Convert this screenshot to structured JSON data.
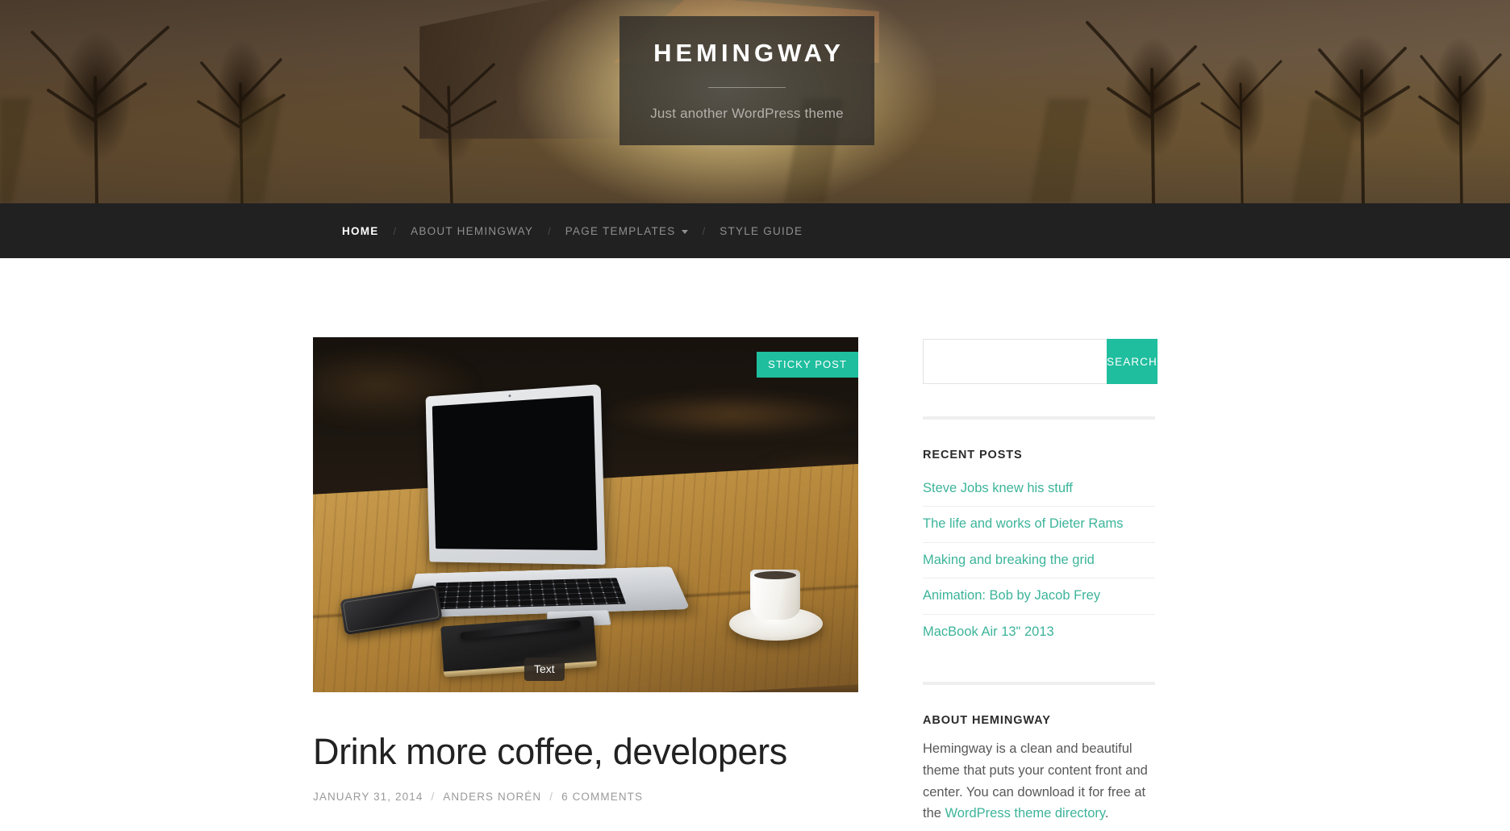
{
  "header": {
    "site_title": "HEMINGWAY",
    "tagline": "Just another WordPress theme",
    "hero_image_alt": "sunset-barn-field-photo"
  },
  "nav": {
    "separator": "/",
    "items": [
      {
        "label": "HOME",
        "active": true,
        "has_dropdown": false
      },
      {
        "label": "ABOUT HEMINGWAY",
        "active": false,
        "has_dropdown": false
      },
      {
        "label": "PAGE TEMPLATES",
        "active": false,
        "has_dropdown": true
      },
      {
        "label": "STYLE GUIDE",
        "active": false,
        "has_dropdown": false
      }
    ]
  },
  "post": {
    "featured_image_alt": "macbook-air-coffee-desk-photo",
    "sticky_badge": "STICKY POST",
    "format_badge": "Text",
    "title": "Drink more coffee, developers",
    "date": "JANUARY 31, 2014",
    "author": "ANDERS NORÉN",
    "comments": "6 COMMENTS",
    "meta_separator": "/"
  },
  "sidebar": {
    "search": {
      "value": "",
      "placeholder": "",
      "button_label": "SEARCH"
    },
    "recent_posts": {
      "title": "RECENT POSTS",
      "items": [
        "Steve Jobs knew his stuff",
        "The life and works of Dieter Rams",
        "Making and breaking the grid",
        "Animation: Bob by Jacob Frey",
        "MacBook Air 13\" 2013"
      ]
    },
    "about": {
      "title": "ABOUT HEMINGWAY",
      "text_before": "Hemingway is a clean and beautiful theme that puts your content front and center. You can download it for free at the ",
      "link_text": "WordPress theme directory",
      "text_after": "."
    }
  },
  "colors": {
    "accent_teal": "#1fbe9e",
    "link_teal": "#3cb49a",
    "nav_bg": "#212121",
    "header_overlay": "rgba(45,44,41,.80)",
    "text_dark": "#222222",
    "meta_gray": "#9a9a9a"
  }
}
